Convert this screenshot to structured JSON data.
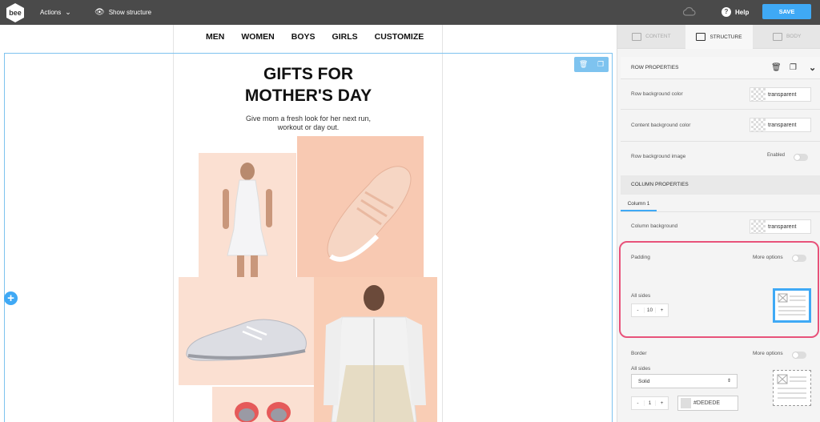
{
  "topbar": {
    "logo": "bee",
    "actions": "Actions",
    "show_structure": "Show structure",
    "help": "Help",
    "save": "SAVE"
  },
  "email": {
    "nav": [
      "MEN",
      "WOMEN",
      "BOYS",
      "GIRLS",
      "CUSTOMIZE"
    ],
    "headline_1": "GIFTS FOR",
    "headline_2": "MOTHER'S DAY",
    "subtext_1": "Give mom a fresh look for her next run,",
    "subtext_2": "workout or day out."
  },
  "panel": {
    "tabs": [
      "CONTENT",
      "STRUCTURE",
      "BODY"
    ],
    "active_tab": "STRUCTURE",
    "row_properties": "ROW PROPERTIES",
    "row_bg_color_label": "Row background color",
    "row_bg_color_value": "transparent",
    "content_bg_color_label": "Content background color",
    "content_bg_color_value": "transparent",
    "row_bg_image_label": "Row background image",
    "row_bg_image_state": "Enabled",
    "column_properties": "COLUMN PROPERTIES",
    "column_tab": "Column 1",
    "column_bg_label": "Column background",
    "column_bg_value": "transparent",
    "padding_label": "Padding",
    "padding_more_options": "More options",
    "padding_all_sides_label": "All sides",
    "padding_value": "10",
    "border_label": "Border",
    "border_more_options": "More options",
    "border_all_sides_label": "All sides",
    "border_style": "Solid",
    "border_width": "1",
    "border_color": "#DEDEDE"
  },
  "colors": {
    "accent": "#3fa9f5",
    "highlight": "#e8527a",
    "topbar": "#4a4a4a",
    "peach": "#f9cdb5"
  }
}
